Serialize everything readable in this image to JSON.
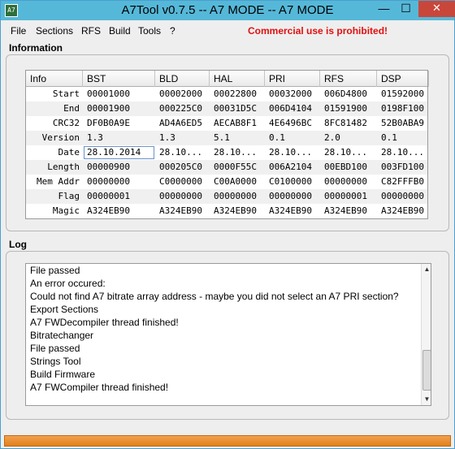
{
  "window": {
    "title": "A7Tool v0.7.5 -- A7 MODE -- A7 MODE",
    "icon_text": "A7"
  },
  "titlebar_buttons": {
    "minimize": "—",
    "maximize": "☐",
    "close": "✕"
  },
  "menu": {
    "items": [
      "File",
      "Sections",
      "RFS",
      "Build",
      "Tools",
      "?"
    ],
    "warning": "Commercial use is prohibited!",
    "warning_color": "#e01010"
  },
  "information": {
    "label": "Information",
    "columns": [
      "Info",
      "BST",
      "BLD",
      "HAL",
      "PRI",
      "RFS",
      "DSP"
    ],
    "rows": [
      {
        "label": "Start",
        "values": [
          "00001000",
          "00002000",
          "00022800",
          "00032000",
          "006D4800",
          "01592000"
        ]
      },
      {
        "label": "End",
        "values": [
          "00001900",
          "000225C0",
          "00031D5C",
          "006D4104",
          "01591900",
          "0198F100"
        ]
      },
      {
        "label": "CRC32",
        "values": [
          "DF0B0A9E",
          "AD4A6ED5",
          "AECAB8F1",
          "4E6496BC",
          "8FC81482",
          "52B0ABA9"
        ]
      },
      {
        "label": "Version",
        "values": [
          "1.3",
          "1.3",
          "5.1",
          "0.1",
          "2.0",
          "0.1"
        ]
      },
      {
        "label": "Date",
        "values": [
          "28.10.2014",
          "28.10...",
          "28.10...",
          "28.10...",
          "28.10...",
          "28.10..."
        ]
      },
      {
        "label": "Length",
        "values": [
          "00000900",
          "000205C0",
          "0000F55C",
          "006A2104",
          "00EBD100",
          "003FD100"
        ]
      },
      {
        "label": "Mem Addr",
        "values": [
          "00000000",
          "C0000000",
          "C00A0000",
          "C0100000",
          "00000000",
          "C82FFFB0"
        ]
      },
      {
        "label": "Flag",
        "values": [
          "00000001",
          "00000000",
          "00000000",
          "00000000",
          "00000001",
          "00000000"
        ]
      },
      {
        "label": "Magic",
        "values": [
          "A324EB90",
          "A324EB90",
          "A324EB90",
          "A324EB90",
          "A324EB90",
          "A324EB90"
        ]
      }
    ]
  },
  "log": {
    "label": "Log",
    "lines": [
      "File passed",
      "An error occured:",
      "Could not find A7 bitrate array address - maybe you did not select an A7 PRI section?",
      "Export Sections",
      "A7 FWDecompiler thread finished!",
      "Bitratechanger",
      "File passed",
      "Strings Tool",
      "Build Firmware",
      "A7 FWCompiler thread finished!"
    ]
  }
}
